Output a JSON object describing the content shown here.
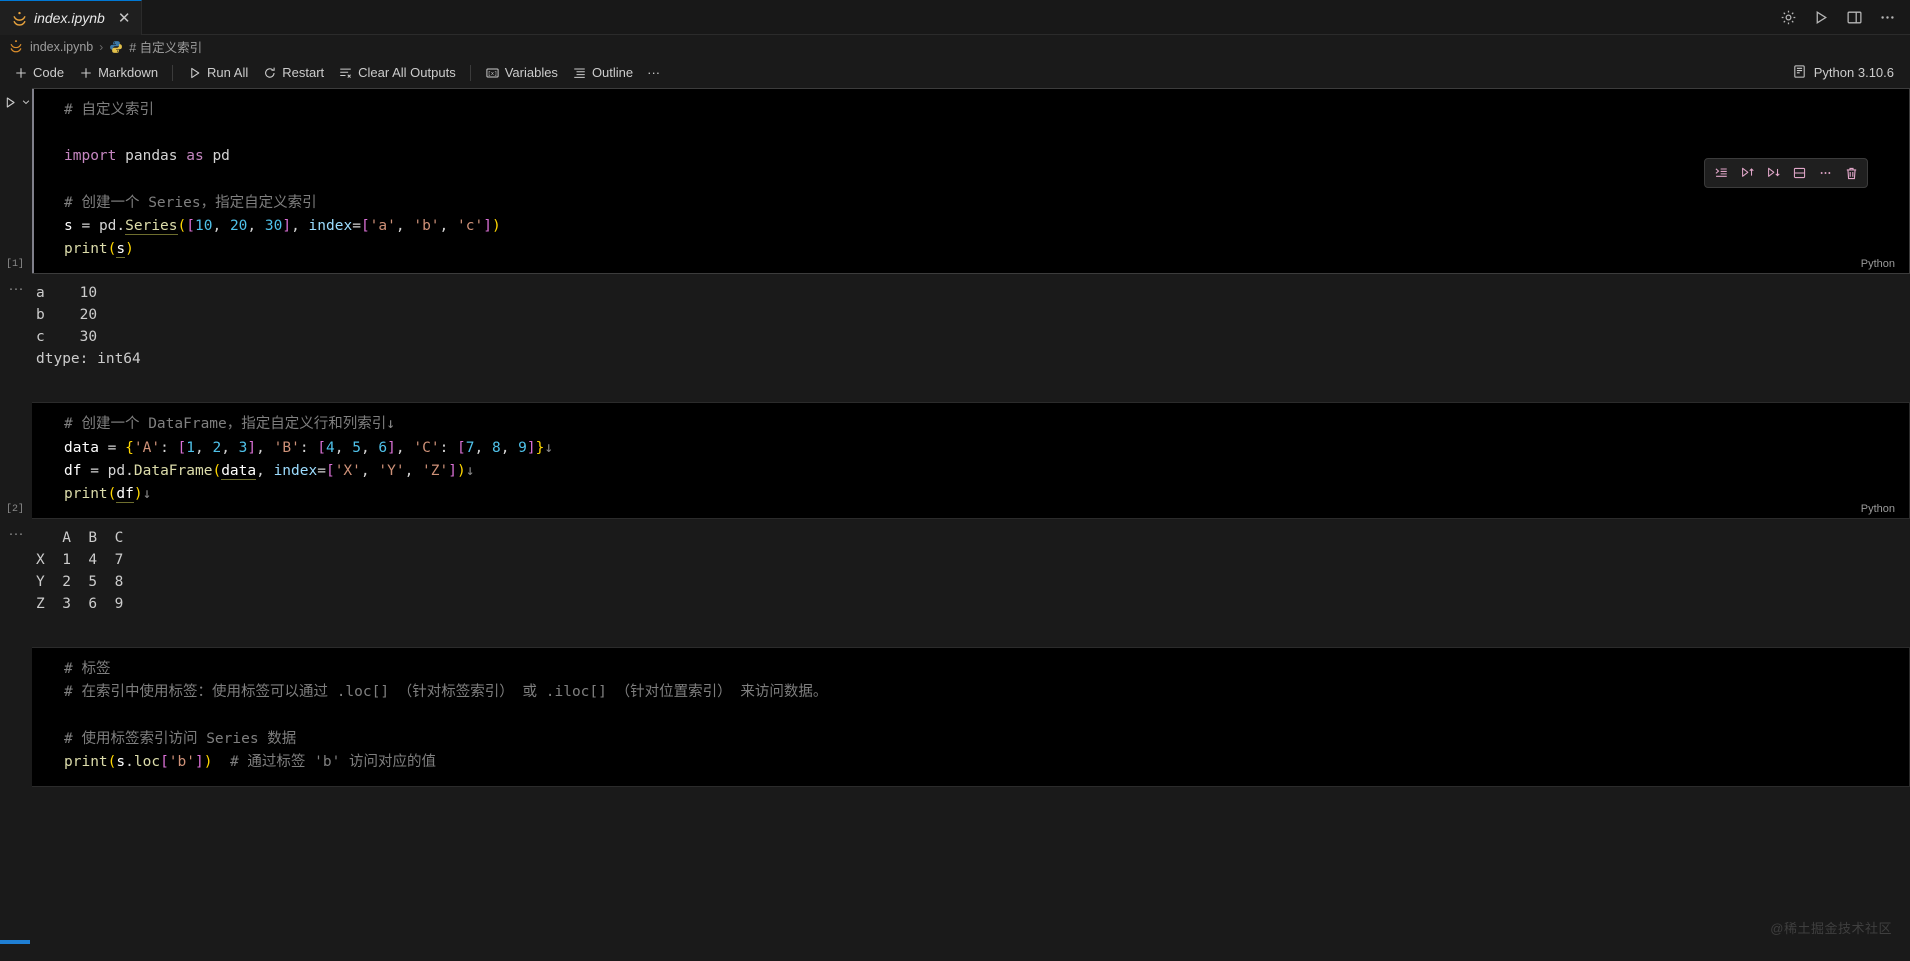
{
  "window": {
    "tab": {
      "label": "index.ipynb",
      "icon": "jupyter-icon",
      "close_label": "✕"
    },
    "title_actions": [
      {
        "name": "settings-icon",
        "label": "gear-icon"
      },
      {
        "name": "run-icon",
        "label": "play-icon"
      },
      {
        "name": "layout-icon",
        "label": "split-editor-icon"
      },
      {
        "name": "more-icon",
        "label": "···"
      }
    ]
  },
  "breadcrumb": {
    "items": [
      {
        "label": "index.ipynb",
        "icon": "jupyter-icon"
      },
      {
        "label": "# 自定义索引",
        "icon": "python-icon"
      }
    ],
    "separator": "›"
  },
  "toolbar": {
    "buttons": [
      {
        "name": "add-code-cell-button",
        "label": "Code",
        "icon": "plus-icon"
      },
      {
        "name": "add-markdown-cell-button",
        "label": "Markdown",
        "icon": "plus-icon"
      },
      {
        "name": "run-all-button",
        "label": "Run All",
        "icon": "play-icon"
      },
      {
        "name": "restart-button",
        "label": "Restart",
        "icon": "restart-icon"
      },
      {
        "name": "clear-all-outputs-button",
        "label": "Clear All Outputs",
        "icon": "clear-outputs-icon"
      },
      {
        "name": "variables-button",
        "label": "Variables",
        "icon": "variables-icon"
      },
      {
        "name": "outline-button",
        "label": "Outline",
        "icon": "outline-icon"
      },
      {
        "name": "more-actions-button",
        "label": "···",
        "icon": "ellipsis-icon"
      }
    ],
    "kernel": {
      "label": "Python 3.10.6",
      "icon": "kernel-icon"
    }
  },
  "cell_toolbar": {
    "buttons": [
      {
        "name": "execute-above-cells-button",
        "icon": "execute-above-icon"
      },
      {
        "name": "run-above-button",
        "icon": "run-above-icon"
      },
      {
        "name": "run-below-button",
        "icon": "run-below-icon"
      },
      {
        "name": "split-cell-button",
        "icon": "split-cell-icon"
      },
      {
        "name": "more-cell-actions-button",
        "icon": "ellipsis-icon"
      },
      {
        "name": "delete-cell-button",
        "icon": "trash-icon"
      }
    ]
  },
  "notebook": {
    "language_badge": "Python",
    "cells": [
      {
        "id": "cell-1",
        "execution_count": "[1]",
        "language": "Python",
        "source_lines": [
          "# 自定义索引",
          "",
          "import pandas as pd",
          "",
          "# 创建一个 Series，指定自定义索引",
          "s = pd.Series([10, 20, 30], index=['a', 'b', 'c'])",
          "print(s)"
        ],
        "output_lines": [
          "a    10",
          "b    20",
          "c    30",
          "dtype: int64"
        ]
      },
      {
        "id": "cell-2",
        "execution_count": "[2]",
        "language": "Python",
        "source_lines": [
          "# 创建一个 DataFrame，指定自定义行和列索引↓",
          "data = {'A': [1, 2, 3], 'B': [4, 5, 6], 'C': [7, 8, 9]}↓",
          "df = pd.DataFrame(data, index=['X', 'Y', 'Z'])↓",
          "print(df)↓"
        ],
        "output_lines": [
          "   A  B  C",
          "X  1  4  7",
          "Y  2  5  8",
          "Z  3  6  9"
        ]
      },
      {
        "id": "cell-3",
        "execution_count": "",
        "language": "Python",
        "source_lines": [
          "# 标签",
          "# 在索引中使用标签：使用标签可以通过 .loc[] （针对标签索引）或 .iloc[] （针对位置索引）来访问数据。",
          "",
          "# 使用标签索引访问 Series 数据",
          "print(s.loc['b'])  # 通过标签 'b' 访问对应的值"
        ],
        "output_lines": []
      }
    ]
  },
  "watermark": {
    "text": "@稀土掘金技术社区"
  },
  "colors": {
    "accent": "#0078d4",
    "editor_background": "#000000",
    "notebook_background": "#1a1a1a",
    "comment": "#7f7f7f",
    "keyword": "#6f9ef8",
    "function": "#dcdcaa",
    "string": "#ce9178",
    "number": "#4fc1e9"
  }
}
